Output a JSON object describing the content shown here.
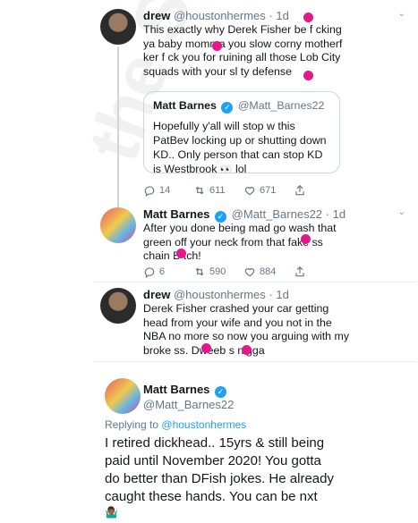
{
  "tweet1": {
    "name": "drew",
    "handle": "@houstonhermes",
    "time": "· 1d",
    "text": "This exactly why Derek Fisher be f  cking ya baby momma you slow corny motherf  ker f ck you for ruining all those Lob City squads with your sl  ty defense",
    "quote": {
      "name": "Matt Barnes",
      "handle": "@Matt_Barnes22",
      "text": "Hopefully y'all will stop w this PatBev locking up or shutting down KD.. Only person that can stop KD is Westbrook",
      "emoji": "👀",
      "suffix": "lol"
    },
    "replies": "14",
    "retweets": "611",
    "likes": "671"
  },
  "tweet2": {
    "name": "Matt Barnes",
    "handle": "@Matt_Barnes22",
    "time": "· 1d",
    "text": "After you done being mad go wash that green off your neck from that fake  ss chain B tch!",
    "replies": "6",
    "retweets": "590",
    "likes": "884"
  },
  "tweet3": {
    "name": "drew",
    "handle": "@houstonhermes",
    "time": "· 1d",
    "text": "Derek Fisher crashed your car getting head from your wife and you not in the NBA no more so now you arguing with my broke  ss. Dweeb  s nigga"
  },
  "tweet4": {
    "name": "Matt Barnes",
    "handle": "@Matt_Barnes22",
    "replying_prefix": "Replying to",
    "replying_to": "@houstonhermes",
    "text": "I retired dickhead.. 15yrs & still being paid until November 2020! You gotta do better than DFish jokes. He already caught these hands. You can be nxt",
    "emoji": "🤷🏾‍♂️"
  },
  "watermark": "the SHADE ROOM",
  "colors": {
    "link": "#1da1f2",
    "muted": "#657786",
    "censor": "#e4178b"
  }
}
